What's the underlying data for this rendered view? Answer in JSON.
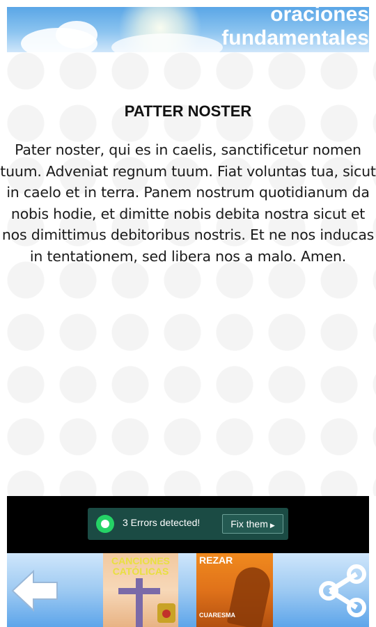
{
  "header": {
    "title_line1": "oraciones",
    "title_line2": "fundamentales"
  },
  "prayer": {
    "title": "PATTER NOSTER",
    "text": "Pater noster, qui es in caelis, sanctificetur nomen tuum. Adveniat regnum tuum. Fiat voluntas tua, sicut in caelo et in terra. Panem nostrum quotidianum da nobis hodie, et dimitte nobis debita nostra sicut et nos dimittimus debitoribus nostris. Et ne nos inducas in tentationem, sed libera nos a malo. Amen."
  },
  "ad": {
    "message": "3 Errors detected!",
    "button_label": "Fix them",
    "icon": "whatsapp-icon"
  },
  "bottom_bar": {
    "back_icon": "back-arrow-icon",
    "promo1": {
      "line1": "CANCIONES",
      "line2": "CATÓLICAS"
    },
    "promo2": {
      "title": "REZAR",
      "subtitle": "CUARESMA"
    },
    "share_icon": "share-icon"
  },
  "colors": {
    "header_sky": "#5aa6e6",
    "ad_background": "#1b4b44",
    "bottom_bar": "#5da5ea",
    "promo2": "#e0721a"
  }
}
